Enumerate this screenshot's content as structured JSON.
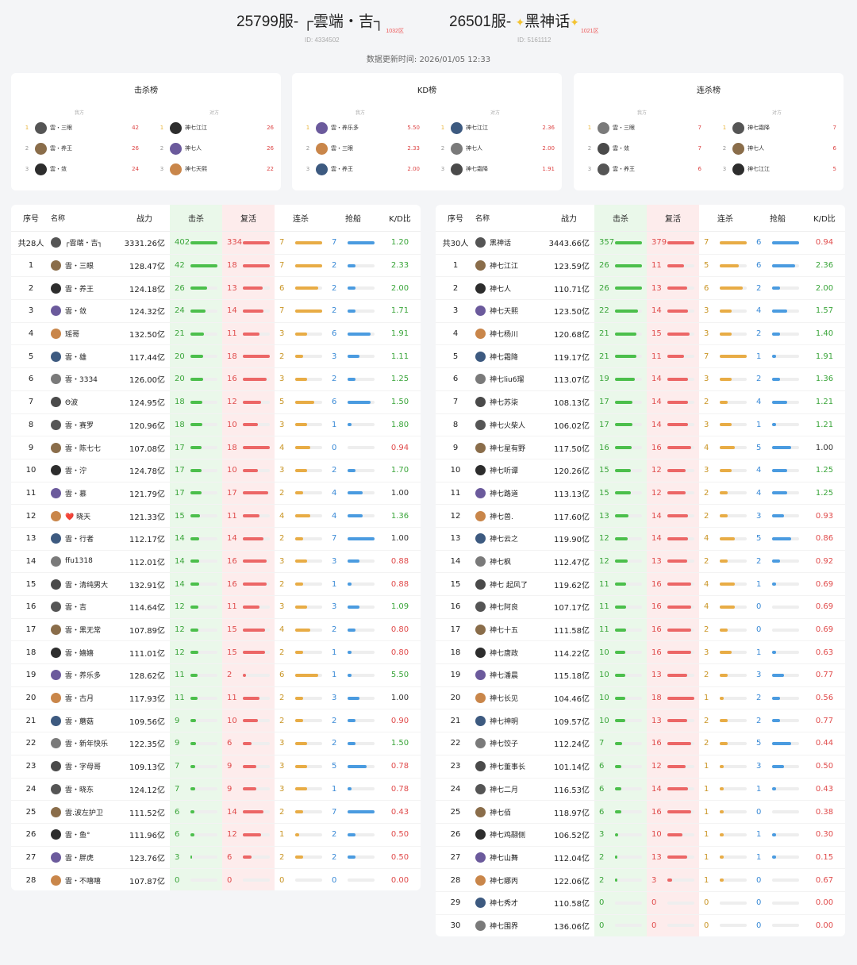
{
  "left_server": {
    "title": "25799服- ┌雲端・吉┐",
    "tag": "1032区",
    "id": "ID: 4334502"
  },
  "right_server": {
    "title": "26501服-",
    "name": "黑神话",
    "tag": "1021区",
    "id": "ID: 5161112"
  },
  "update_time": "数据更新时间:  2026/01/05 12:33",
  "colors": {
    "kill": "#4bbf4b",
    "death": "#ec6666",
    "streak": "#e8ac45",
    "grab": "#4a9be0"
  },
  "cards": [
    {
      "title": "击杀榜",
      "our": "我方",
      "enemy": "对方",
      "left": [
        {
          "rank": "1",
          "name": "雲・三眼",
          "value": "42"
        },
        {
          "rank": "2",
          "name": "雲・养王",
          "value": "26"
        },
        {
          "rank": "3",
          "name": "雲・敛",
          "value": "24"
        }
      ],
      "right": [
        {
          "rank": "1",
          "name": "神七江江",
          "value": "26"
        },
        {
          "rank": "2",
          "name": "神七人",
          "value": "26"
        },
        {
          "rank": "3",
          "name": "神七天熙",
          "value": "22"
        }
      ]
    },
    {
      "title": "KD榜",
      "our": "我方",
      "enemy": "对方",
      "left": [
        {
          "rank": "1",
          "name": "雲・养乐多",
          "value": "5.50"
        },
        {
          "rank": "2",
          "name": "雲・三眼",
          "value": "2.33"
        },
        {
          "rank": "3",
          "name": "雲・养王",
          "value": "2.00"
        }
      ],
      "right": [
        {
          "rank": "1",
          "name": "神七江江",
          "value": "2.36"
        },
        {
          "rank": "2",
          "name": "神七人",
          "value": "2.00"
        },
        {
          "rank": "3",
          "name": "神七霜降",
          "value": "1.91"
        }
      ]
    },
    {
      "title": "连杀榜",
      "our": "我方",
      "enemy": "对方",
      "left": [
        {
          "rank": "1",
          "name": "雲・三眼",
          "value": "7"
        },
        {
          "rank": "2",
          "name": "雲・敛",
          "value": "7"
        },
        {
          "rank": "3",
          "name": "雲・养王",
          "value": "6"
        }
      ],
      "right": [
        {
          "rank": "1",
          "name": "神七霜降",
          "value": "7"
        },
        {
          "rank": "2",
          "name": "神七人",
          "value": "6"
        },
        {
          "rank": "3",
          "name": "神七江江",
          "value": "5"
        }
      ]
    }
  ],
  "headers": [
    "序号",
    "名称",
    "战力",
    "击杀",
    "复活",
    "连杀",
    "抢船",
    "K/D比"
  ],
  "left_table": {
    "total": [
      "共28人",
      "┌雲端・吉┐",
      "3331.26亿",
      "402",
      "334",
      "7",
      "7",
      "1.20"
    ],
    "rows": [
      [
        "1",
        "雲・三眼",
        "128.47亿",
        "42",
        "18",
        "7",
        "2",
        "2.33"
      ],
      [
        "2",
        "雲・养王",
        "124.18亿",
        "26",
        "13",
        "6",
        "2",
        "2.00"
      ],
      [
        "3",
        "雲・敛",
        "124.32亿",
        "24",
        "14",
        "7",
        "2",
        "1.71"
      ],
      [
        "4",
        "瑶哥",
        "132.50亿",
        "21",
        "11",
        "3",
        "6",
        "1.91"
      ],
      [
        "5",
        "雲・雄",
        "117.44亿",
        "20",
        "18",
        "2",
        "3",
        "1.11"
      ],
      [
        "6",
        "雲・3334",
        "126.00亿",
        "20",
        "16",
        "3",
        "2",
        "1.25"
      ],
      [
        "7",
        "Θ波",
        "124.95亿",
        "18",
        "12",
        "5",
        "6",
        "1.50"
      ],
      [
        "8",
        "雲・赛罗",
        "120.96亿",
        "18",
        "10",
        "3",
        "1",
        "1.80"
      ],
      [
        "9",
        "雲・陈七七",
        "107.08亿",
        "17",
        "18",
        "4",
        "0",
        "0.94"
      ],
      [
        "10",
        "雲・泞",
        "124.78亿",
        "17",
        "10",
        "3",
        "2",
        "1.70"
      ],
      [
        "11",
        "雲・慕",
        "121.79亿",
        "17",
        "17",
        "2",
        "4",
        "1.00"
      ],
      [
        "12",
        "❤️ 晓天",
        "121.33亿",
        "15",
        "11",
        "4",
        "4",
        "1.36"
      ],
      [
        "13",
        "雲・行者",
        "112.17亿",
        "14",
        "14",
        "2",
        "7",
        "1.00"
      ],
      [
        "14",
        "ffu1318",
        "112.01亿",
        "14",
        "16",
        "3",
        "3",
        "0.88"
      ],
      [
        "15",
        "雲・清纯男大",
        "132.91亿",
        "14",
        "16",
        "2",
        "1",
        "0.88"
      ],
      [
        "16",
        "雲・吉",
        "114.64亿",
        "12",
        "11",
        "3",
        "3",
        "1.09"
      ],
      [
        "17",
        "雲・黑无常",
        "107.89亿",
        "12",
        "15",
        "4",
        "2",
        "0.80"
      ],
      [
        "18",
        "雲・嬉嬉",
        "111.01亿",
        "12",
        "15",
        "2",
        "1",
        "0.80"
      ],
      [
        "19",
        "雲・养乐多",
        "128.62亿",
        "11",
        "2",
        "6",
        "1",
        "5.50"
      ],
      [
        "20",
        "雲・古月",
        "117.93亿",
        "11",
        "11",
        "2",
        "3",
        "1.00"
      ],
      [
        "21",
        "雲・蘑菇",
        "109.56亿",
        "9",
        "10",
        "2",
        "2",
        "0.90"
      ],
      [
        "22",
        "雲・新年快乐",
        "122.35亿",
        "9",
        "6",
        "3",
        "2",
        "1.50"
      ],
      [
        "23",
        "雲・字母哥",
        "109.13亿",
        "7",
        "9",
        "3",
        "5",
        "0.78"
      ],
      [
        "24",
        "雲・晓东",
        "124.12亿",
        "7",
        "9",
        "3",
        "1",
        "0.78"
      ],
      [
        "25",
        "雲.波左护卫",
        "111.52亿",
        "6",
        "14",
        "2",
        "7",
        "0.43"
      ],
      [
        "26",
        "雲・鱼°",
        "111.96亿",
        "6",
        "12",
        "1",
        "2",
        "0.50"
      ],
      [
        "27",
        "雲・胖虎",
        "123.76亿",
        "3",
        "6",
        "2",
        "2",
        "0.50"
      ],
      [
        "28",
        "雲・不嘻嘻",
        "107.87亿",
        "0",
        "0",
        "0",
        "0",
        "0.00"
      ]
    ]
  },
  "right_table": {
    "total": [
      "共30人",
      "黑神话",
      "3443.66亿",
      "357",
      "379",
      "7",
      "6",
      "0.94"
    ],
    "rows": [
      [
        "1",
        "神七江江",
        "123.59亿",
        "26",
        "11",
        "5",
        "6",
        "2.36"
      ],
      [
        "2",
        "神七人",
        "110.71亿",
        "26",
        "13",
        "6",
        "2",
        "2.00"
      ],
      [
        "3",
        "神七天熙",
        "123.50亿",
        "22",
        "14",
        "3",
        "4",
        "1.57"
      ],
      [
        "4",
        "神七杨川",
        "120.68亿",
        "21",
        "15",
        "3",
        "2",
        "1.40"
      ],
      [
        "5",
        "神七霜降",
        "119.17亿",
        "21",
        "11",
        "7",
        "1",
        "1.91"
      ],
      [
        "6",
        "神七liu6瑠",
        "113.07亿",
        "19",
        "14",
        "3",
        "2",
        "1.36"
      ],
      [
        "7",
        "神七苏柒",
        "108.13亿",
        "17",
        "14",
        "2",
        "4",
        "1.21"
      ],
      [
        "8",
        "神七火柴人",
        "106.02亿",
        "17",
        "14",
        "3",
        "1",
        "1.21"
      ],
      [
        "9",
        "神七星有野",
        "117.50亿",
        "16",
        "16",
        "4",
        "5",
        "1.00"
      ],
      [
        "10",
        "神七听谭",
        "120.26亿",
        "15",
        "12",
        "3",
        "4",
        "1.25"
      ],
      [
        "11",
        "神七路道",
        "113.13亿",
        "15",
        "12",
        "2",
        "4",
        "1.25"
      ],
      [
        "12",
        "神七兽.",
        "117.60亿",
        "13",
        "14",
        "2",
        "3",
        "0.93"
      ],
      [
        "13",
        "神七云之",
        "119.90亿",
        "12",
        "14",
        "4",
        "5",
        "0.86"
      ],
      [
        "14",
        "神七枫",
        "112.47亿",
        "12",
        "13",
        "2",
        "2",
        "0.92"
      ],
      [
        "15",
        "神七 起风了",
        "119.62亿",
        "11",
        "16",
        "4",
        "1",
        "0.69"
      ],
      [
        "16",
        "神七阿良",
        "107.17亿",
        "11",
        "16",
        "4",
        "0",
        "0.69"
      ],
      [
        "17",
        "神七十五",
        "111.58亿",
        "11",
        "16",
        "2",
        "0",
        "0.69"
      ],
      [
        "18",
        "神七唐政",
        "114.22亿",
        "10",
        "16",
        "3",
        "1",
        "0.63"
      ],
      [
        "19",
        "神七潘晨",
        "115.18亿",
        "10",
        "13",
        "2",
        "3",
        "0.77"
      ],
      [
        "20",
        "神七长见",
        "104.46亿",
        "10",
        "18",
        "1",
        "2",
        "0.56"
      ],
      [
        "21",
        "神七神明",
        "109.57亿",
        "10",
        "13",
        "2",
        "2",
        "0.77"
      ],
      [
        "22",
        "神七饺子",
        "112.24亿",
        "7",
        "16",
        "2",
        "5",
        "0.44"
      ],
      [
        "23",
        "神七董事长",
        "101.14亿",
        "6",
        "12",
        "1",
        "3",
        "0.50"
      ],
      [
        "24",
        "神七二月",
        "116.53亿",
        "6",
        "14",
        "1",
        "1",
        "0.43"
      ],
      [
        "25",
        "神七佰",
        "118.97亿",
        "6",
        "16",
        "1",
        "0",
        "0.38"
      ],
      [
        "26",
        "神七鸡翮侧",
        "106.52亿",
        "3",
        "10",
        "1",
        "1",
        "0.30"
      ],
      [
        "27",
        "神七山舞",
        "112.04亿",
        "2",
        "13",
        "1",
        "1",
        "0.15"
      ],
      [
        "28",
        "神七娜丙",
        "122.06亿",
        "2",
        "3",
        "1",
        "0",
        "0.67"
      ],
      [
        "29",
        "神七秀才",
        "110.58亿",
        "0",
        "0",
        "0",
        "0",
        "0.00"
      ],
      [
        "30",
        "神七围界",
        "136.06亿",
        "0",
        "0",
        "0",
        "0",
        "0.00"
      ]
    ]
  }
}
